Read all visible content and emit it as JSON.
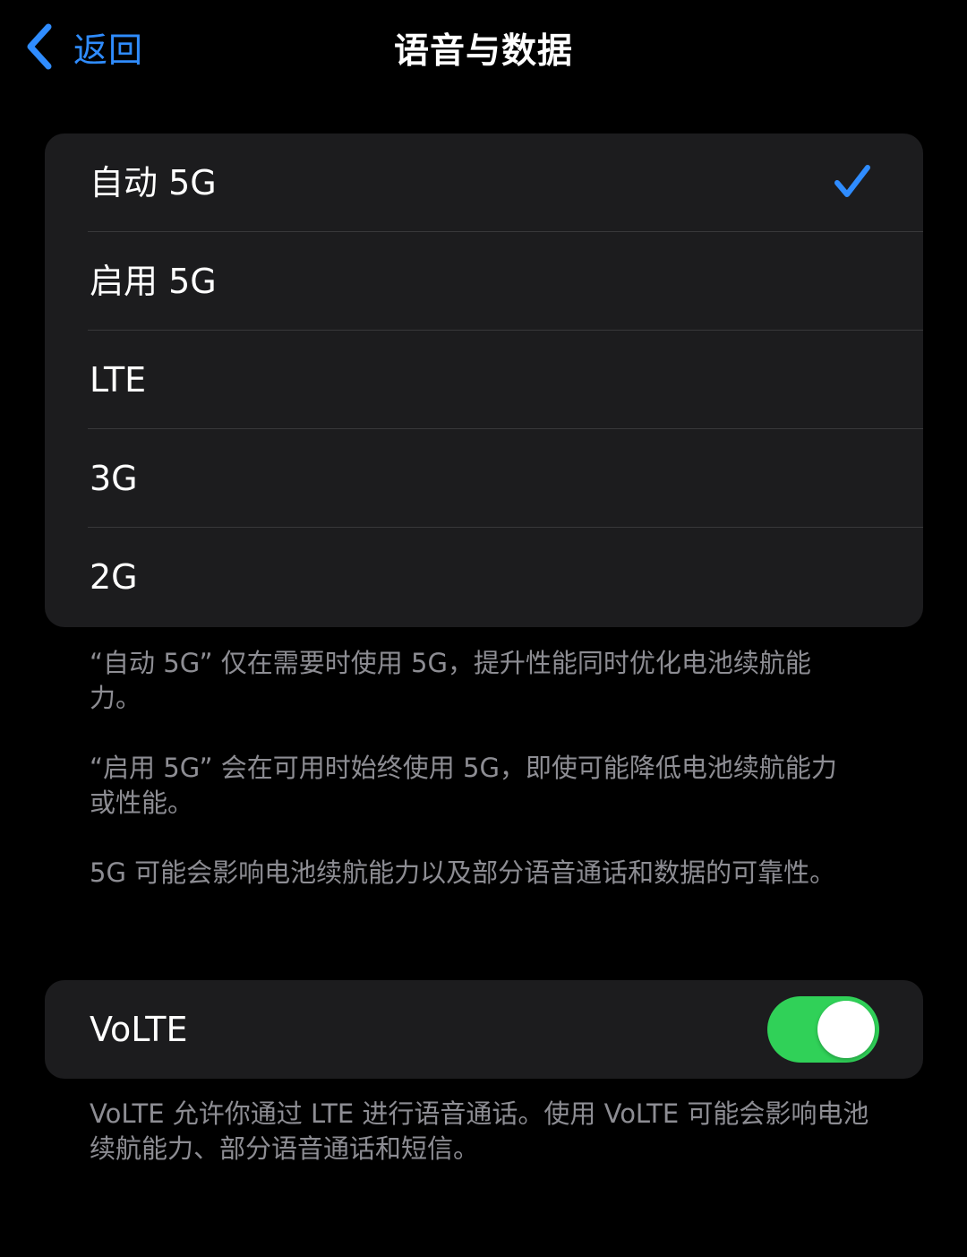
{
  "nav": {
    "back_label": "返回",
    "title": "语音与数据"
  },
  "network": {
    "options": [
      {
        "label": "自动 5G",
        "selected": true
      },
      {
        "label": "启用 5G",
        "selected": false
      },
      {
        "label": "LTE",
        "selected": false
      },
      {
        "label": "3G",
        "selected": false
      },
      {
        "label": "2G",
        "selected": false
      }
    ],
    "notes": [
      "“自动 5G” 仅在需要时使用 5G，提升性能同时优化电池续航能力。",
      "“启用 5G” 会在可用时始终使用 5G，即使可能降低电池续航能力或性能。",
      "5G 可能会影响电池续航能力以及部分语音通话和数据的可靠性。"
    ]
  },
  "volte": {
    "label": "VoLTE",
    "enabled": true,
    "note": "VoLTE 允许你通过 LTE 进行语音通话。使用 VoLTE 可能会影响电池续航能力、部分语音通话和短信。"
  },
  "colors": {
    "accent": "#2f8cff",
    "toggle_on": "#30d158",
    "group_bg": "#1c1c1e",
    "secondary_text": "#8d8d93"
  },
  "icons": {
    "back": "chevron-left-icon",
    "check": "checkmark-icon"
  }
}
